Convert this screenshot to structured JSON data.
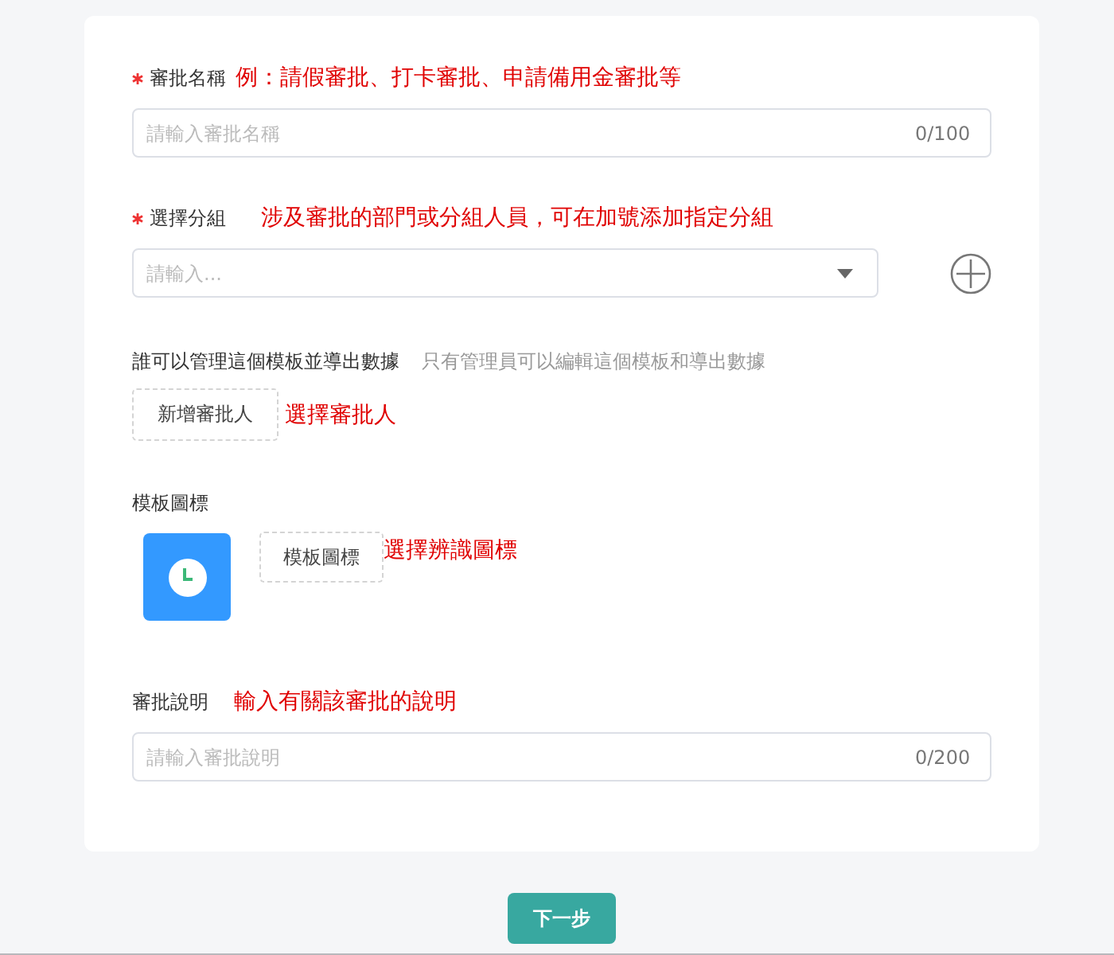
{
  "fields": [
    {
      "kind": "text",
      "label": "審批名稱",
      "required": true,
      "note": "例：請假審批、打卡審批、申請備用金審批等",
      "placeholder": "請輸入審批名稱",
      "counter": "0/100"
    },
    {
      "kind": "select",
      "label": "選擇分組",
      "required": true,
      "note": "涉及審批的部門或分組人員，可在加號添加指定分組",
      "placeholder": "請輸入..."
    },
    {
      "kind": "approver",
      "label": "誰可以管理這個模板並導出數據",
      "hint": "只有管理員可以編輯這個模板和導出數據",
      "button": "新增審批人",
      "note": "選擇審批人"
    },
    {
      "kind": "icon",
      "label": "模板圖標",
      "button": "模板圖標",
      "note": "選擇辨識圖標"
    },
    {
      "kind": "text",
      "label": "審批說明",
      "required": false,
      "note": "輸入有關該審批的說明",
      "placeholder": "請輸入審批說明",
      "counter": "0/200"
    }
  ],
  "next_button": "下一步"
}
